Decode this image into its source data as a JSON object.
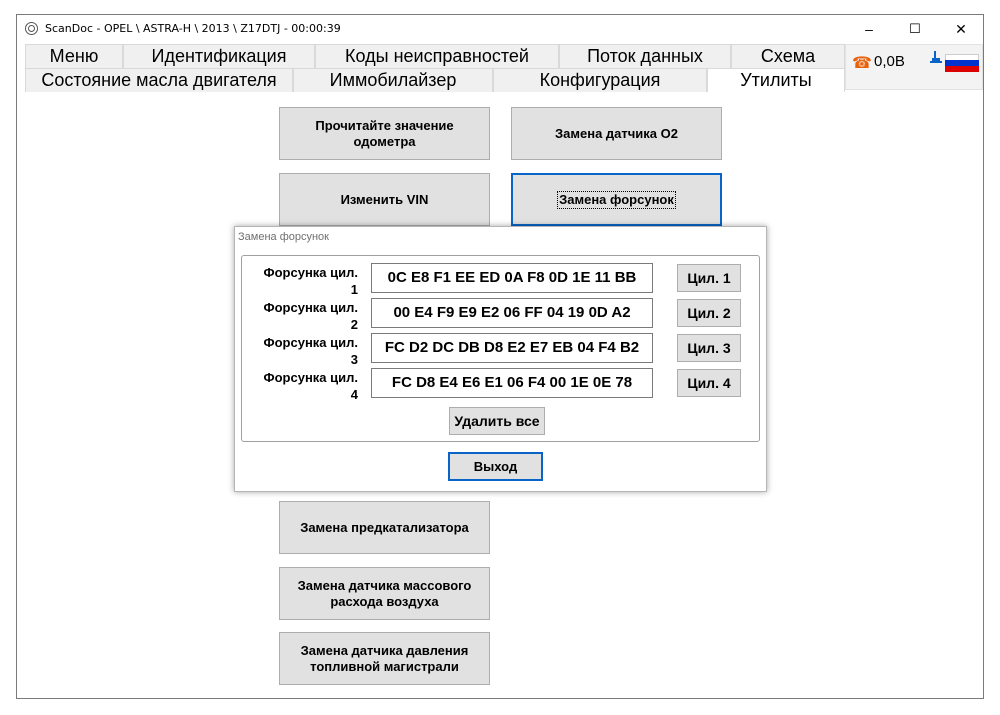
{
  "window": {
    "title": "ScanDoc - OPEL \\ ASTRA-H \\ 2013 \\ Z17DTJ - 00:00:39",
    "controls": {
      "minimize": "–",
      "maximize": "☐",
      "close": "✕"
    }
  },
  "tabs_row1": [
    {
      "label": "Меню"
    },
    {
      "label": "Идентификация"
    },
    {
      "label": "Коды неисправностей"
    },
    {
      "label": "Поток данных"
    },
    {
      "label": "Схема"
    }
  ],
  "tabs_row2": [
    {
      "label": "Состояние масла двигателя"
    },
    {
      "label": "Иммобилайзер"
    },
    {
      "label": "Конфигурация"
    },
    {
      "label": "Утилиты",
      "active": true
    }
  ],
  "status": {
    "phone_icon": "phone-icon",
    "voltage": "0,0В",
    "plug_icon": "plug-icon",
    "flag_colors": [
      "#ffffff",
      "#0033cc",
      "#dd0000"
    ]
  },
  "utilities": {
    "read_odometer": "Прочитайте значение одометра",
    "replace_o2": "Замена датчика O2",
    "change_vin": "Изменить VIN",
    "replace_injectors": "Замена форсунок",
    "replace_precat": "Замена предкатализатора",
    "replace_maf": "Замена датчика массового расхода воздуха",
    "replace_fuel_pressure": "Замена датчика давления топливной магистрали"
  },
  "dialog": {
    "title": "Замена форсунок",
    "injectors": [
      {
        "label_line1": "Форсунка цил.",
        "label_line2": "1",
        "code": "0C E8 F1 EE ED 0A F8 0D 1E 11 BB",
        "button": "Цил. 1"
      },
      {
        "label_line1": "Форсунка цил.",
        "label_line2": "2",
        "code": "00 E4 F9 E9 E2 06 FF 04 19 0D A2",
        "button": "Цил. 2"
      },
      {
        "label_line1": "Форсунка цил.",
        "label_line2": "3",
        "code": "FC D2 DC DB D8 E2 E7 EB 04 F4 B2",
        "button": "Цил. 3"
      },
      {
        "label_line1": "Форсунка цил.",
        "label_line2": "4",
        "code": "FC D8 E4 E6 E1 06 F4 00 1E 0E 78",
        "button": "Цил. 4"
      }
    ],
    "delete_all": "Удалить все",
    "exit": "Выход"
  }
}
